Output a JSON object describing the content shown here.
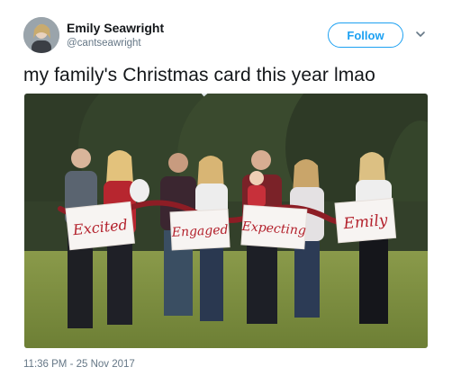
{
  "tweet": {
    "author_name": "Emily Seawright",
    "author_handle": "@cantseawright",
    "follow_label": "Follow",
    "text": "my family's Christmas card this year lmao",
    "timestamp": "11:36 PM - 25 Nov 2017"
  },
  "photo": {
    "signs": [
      "Excited",
      "Engaged",
      "Expecting",
      "Emily"
    ]
  },
  "icons": {
    "more": "chevron-down-icon"
  },
  "colors": {
    "accent": "#1da1f2",
    "secondary_text": "#657786",
    "primary_text": "#14171a",
    "sign_lettering": "#b3202b"
  }
}
